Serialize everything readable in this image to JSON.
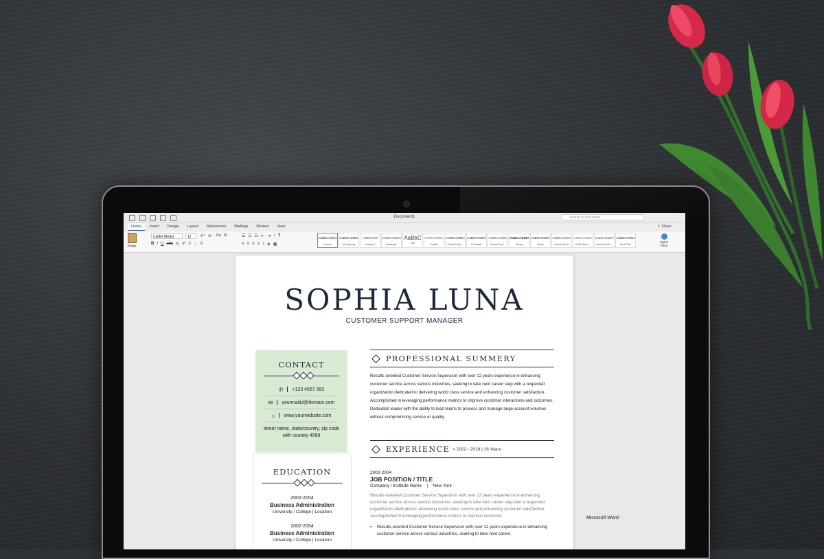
{
  "word": {
    "doc_title": "Document1",
    "search_placeholder": "Search in Document",
    "tabs": [
      "Home",
      "Insert",
      "Design",
      "Layout",
      "References",
      "Mailings",
      "Review",
      "View"
    ],
    "share": "Share",
    "paste": "Paste",
    "font": "Calibri (Body)",
    "size": "12",
    "styles_pane": "Styles Pane",
    "styles": [
      {
        "sample": "AaBbCcDdEe",
        "name": "Normal"
      },
      {
        "sample": "AaBbCcDdEe",
        "name": "No Spacing"
      },
      {
        "sample": "AaBbCcDd",
        "name": "Heading 1"
      },
      {
        "sample": "AaBbCcDdEe",
        "name": "Heading 2"
      },
      {
        "sample": "AaBbC",
        "name": "Title"
      },
      {
        "sample": "AaBbCcDdEe",
        "name": "Subtitle"
      },
      {
        "sample": "AaBbCcDdEe",
        "name": "Subtle Emph..."
      },
      {
        "sample": "AaBbCcDdEe",
        "name": "Emphasis"
      },
      {
        "sample": "AaBbCcDdEe",
        "name": "Intense Emp..."
      },
      {
        "sample": "AaBbCcDdEe",
        "name": "Strong"
      },
      {
        "sample": "AaBbCcDdEe",
        "name": "Quote"
      },
      {
        "sample": "AaBbCcDdEe",
        "name": "Intense Quote"
      },
      {
        "sample": "AaBbCcDdEe",
        "name": "Subtle Refer..."
      },
      {
        "sample": "AaBbCcDdEe",
        "name": "Intense Refer..."
      },
      {
        "sample": "AaBbCcDdEe",
        "name": "Book Title"
      }
    ]
  },
  "resume": {
    "name": "SOPHIA LUNA",
    "title": "CUSTOMER SUPPORT MANAGER",
    "contact": {
      "heading": "CONTACT",
      "phone": "+123 4567 893",
      "email": "yourmailid@domain.com",
      "website": "www.yourwebsite.com",
      "address_line1": "street name, state/country, zip code",
      "address_line2": "with country 4568"
    },
    "education": {
      "heading": "EDUCATION",
      "items": [
        {
          "years": "2002-2004",
          "degree": "Business Administration",
          "school": "University / College | Location"
        },
        {
          "years": "2002-2004",
          "degree": "Business Administration",
          "school": "University / College | Location"
        }
      ]
    },
    "summary": {
      "heading": "PROFESSIONAL SUMMERY",
      "text": "Results-oriented Customer Service Supervisor with over 12 years experience in enhancing customer service across various industries, seeking to take next career step with a respected organization dedicated to delivering world class service and enhancing customer satisfaction. Accomplished in leveraging performance metrics to improve customer interactions and outcomes. Dedicated leader with the ability to lead teams to process and manage large account volumes without compromising service or quality."
    },
    "experience": {
      "heading": "EXPERIENCE",
      "range": "> 2002 - 2018 | 16 Years",
      "years": "2002-2004",
      "position": "JOB POSITION / TITLE",
      "company": "Company / Institute Name    |    New York",
      "description": "Results-oriented Customer Service Supervisor with over 12 years experience in enhancing customer service across various industries, seeking to take next career step with a respected organization dedicated to delivering world class service and enhancing customer satisfaction. Accomplished in leveraging performance metrics to improve customer.",
      "bullet": "Results-oriented Customer Service Supervisor with over 12 years experience in enhancing customer service across various industries, seeking to take next career."
    }
  },
  "dock": {
    "tooltip": "Microsoft Word",
    "apps": [
      {
        "icon": "teamviewer-icon",
        "color": "#1a6fd6"
      },
      {
        "icon": "word-icon",
        "color": "#2b579a"
      },
      {
        "icon": "notes-icon",
        "color": "#f3f3f3"
      },
      {
        "icon": "powerpoint-icon",
        "color": "#d24726"
      }
    ]
  }
}
